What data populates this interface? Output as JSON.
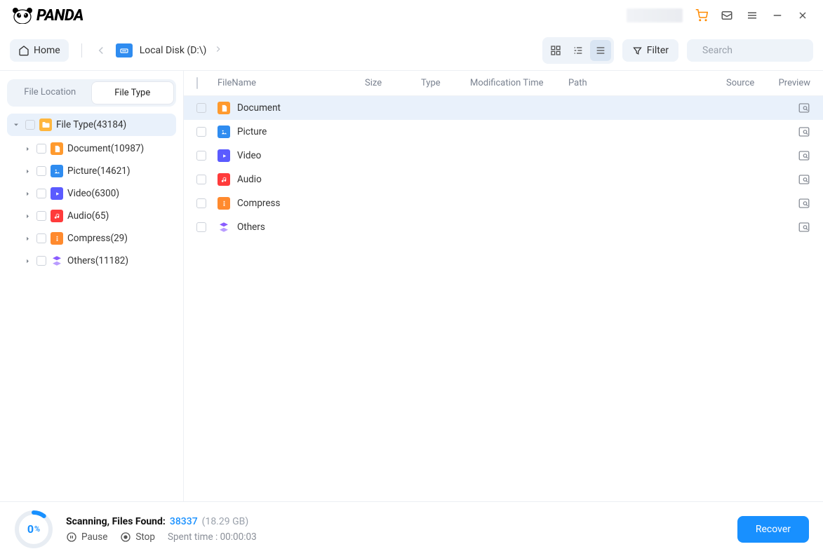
{
  "app": {
    "name": "PANDA"
  },
  "titlebar_icons": {
    "cart": "cart",
    "inbox": "inbox",
    "menu": "menu",
    "minimize": "minimize",
    "close": "close"
  },
  "toolbar": {
    "home": "Home",
    "location": "Local Disk (D:\\)",
    "filter": "Filter",
    "search_placeholder": "Search"
  },
  "sidebar": {
    "tabs": {
      "location": "File Location",
      "type": "File Type"
    },
    "root": {
      "label": "File Type",
      "count": "(43184)"
    },
    "items": [
      {
        "key": "document",
        "label": "Document",
        "count": "(10987)",
        "icon": "doc-orange"
      },
      {
        "key": "picture",
        "label": "Picture",
        "count": "(14621)",
        "icon": "pic-blue"
      },
      {
        "key": "video",
        "label": "Video",
        "count": "(6300)",
        "icon": "vid-purple"
      },
      {
        "key": "audio",
        "label": "Audio",
        "count": "(65)",
        "icon": "aud-red"
      },
      {
        "key": "compress",
        "label": "Compress",
        "count": "(29)",
        "icon": "zip-orange"
      },
      {
        "key": "others",
        "label": "Others",
        "count": "(11182)",
        "icon": "other-purple"
      }
    ]
  },
  "columns": {
    "name": "FileName",
    "size": "Size",
    "type": "Type",
    "mtime": "Modification Time",
    "path": "Path",
    "source": "Source",
    "preview": "Preview"
  },
  "rows": [
    {
      "name": "Document",
      "icon": "doc-orange",
      "selected": true
    },
    {
      "name": "Picture",
      "icon": "pic-blue",
      "selected": false
    },
    {
      "name": "Video",
      "icon": "vid-purple",
      "selected": false
    },
    {
      "name": "Audio",
      "icon": "aud-red",
      "selected": false
    },
    {
      "name": "Compress",
      "icon": "zip-orange",
      "selected": false
    },
    {
      "name": "Others",
      "icon": "other-purple",
      "selected": false
    }
  ],
  "footer": {
    "percent": "0",
    "percent_unit": "%",
    "status": "Scanning, Files Found:",
    "count": "38337",
    "size": "(18.29 GB)",
    "pause": "Pause",
    "stop": "Stop",
    "spent": "Spent time : 00:00:03",
    "recover": "Recover"
  }
}
